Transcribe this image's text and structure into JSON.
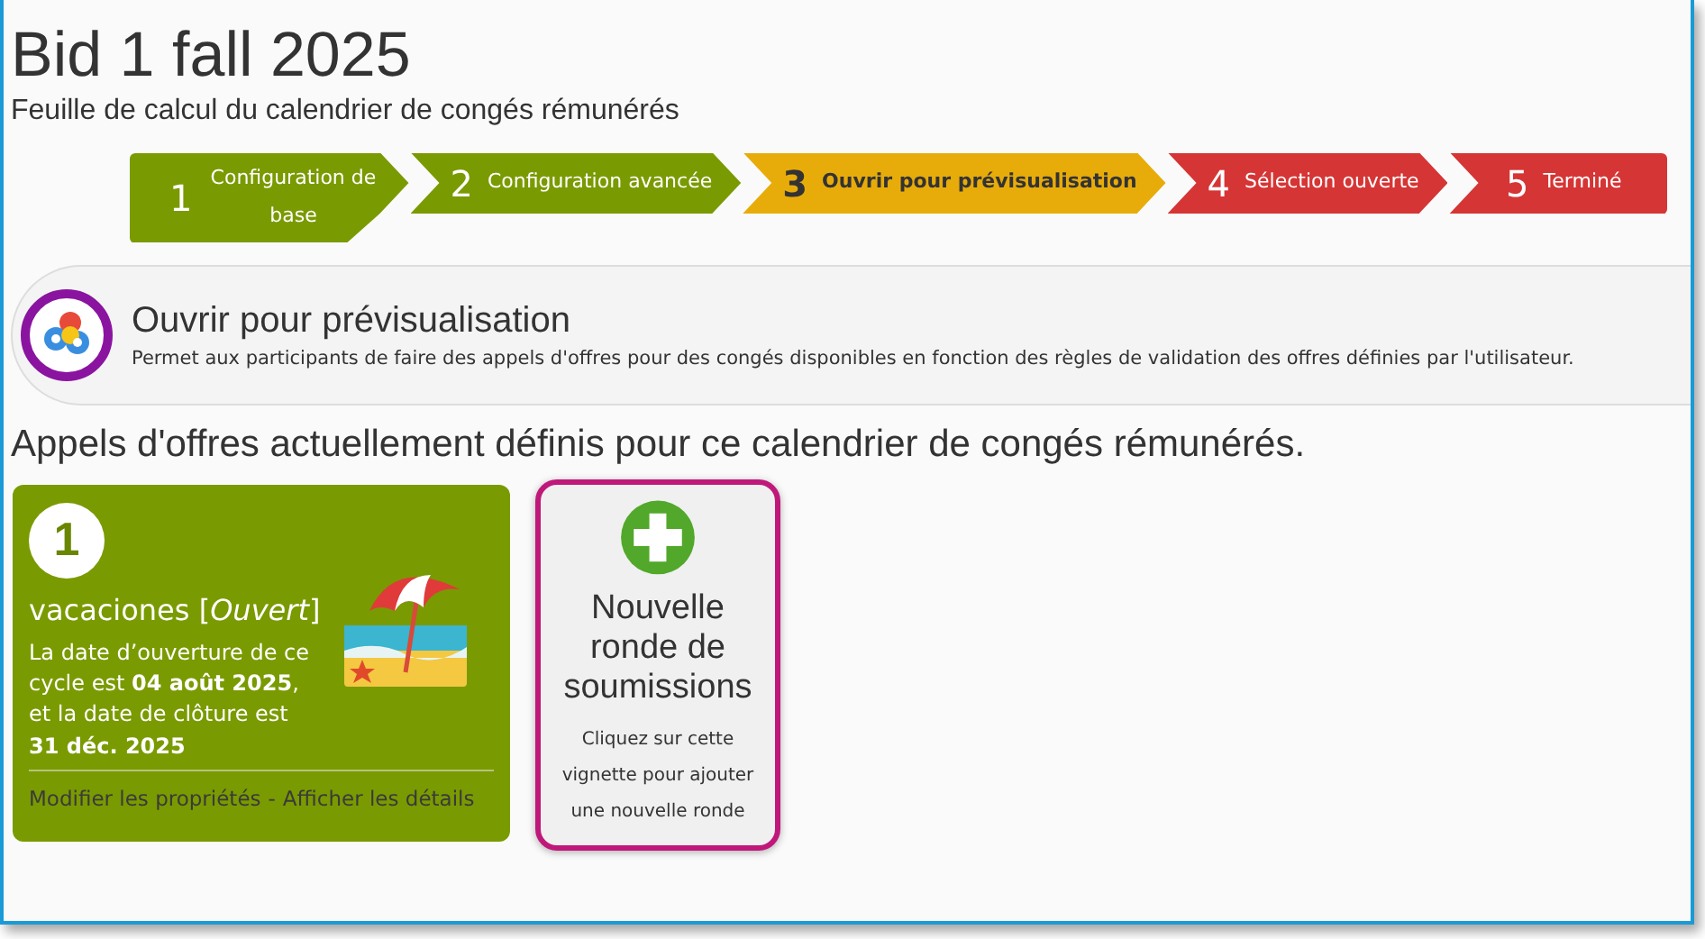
{
  "title": "Bid 1 fall 2025",
  "subtitle": "Feuille de calcul du calendrier de congés rémunérés",
  "steps": [
    {
      "number": "1",
      "label": "Configuration de base",
      "selected": false,
      "color": "#7a9a01"
    },
    {
      "number": "2",
      "label": "Configuration avancée",
      "selected": false,
      "color": "#7a9a01"
    },
    {
      "number": "3",
      "label": "Ouvrir pour prévisualisation",
      "selected": true,
      "color": "#e8ac0a"
    },
    {
      "number": "4",
      "label": "Sélection ouverte",
      "selected": false,
      "color": "#d63535"
    },
    {
      "number": "5",
      "label": "Terminé",
      "selected": false,
      "color": "#d63535"
    }
  ],
  "phase": {
    "title": "Ouvrir pour prévisualisation",
    "description": "Permet aux participants de faire des appels d'offres pour des congés disponibles en fonction des règles de validation des offres définies par l'utilisateur."
  },
  "rounds_heading": "Appels d'offres actuellement définis pour ce calendrier de congés rémunérés.",
  "rounds": [
    {
      "number": "1",
      "name": "vacaciones",
      "status": "[*Ouvert*]",
      "description": "La date d’ouverture de ce cycle est **04 août 2025**, et la date de clôture est **31 déc. 2025**",
      "links": [
        "Modifier les propriétés",
        "Afficher les détails"
      ],
      "separator": "-"
    }
  ],
  "new_round": {
    "title": "Nouvelle ronde de soumissions",
    "hint": "Cliquez sur cette vignette pour ajouter une nouvelle ronde"
  }
}
